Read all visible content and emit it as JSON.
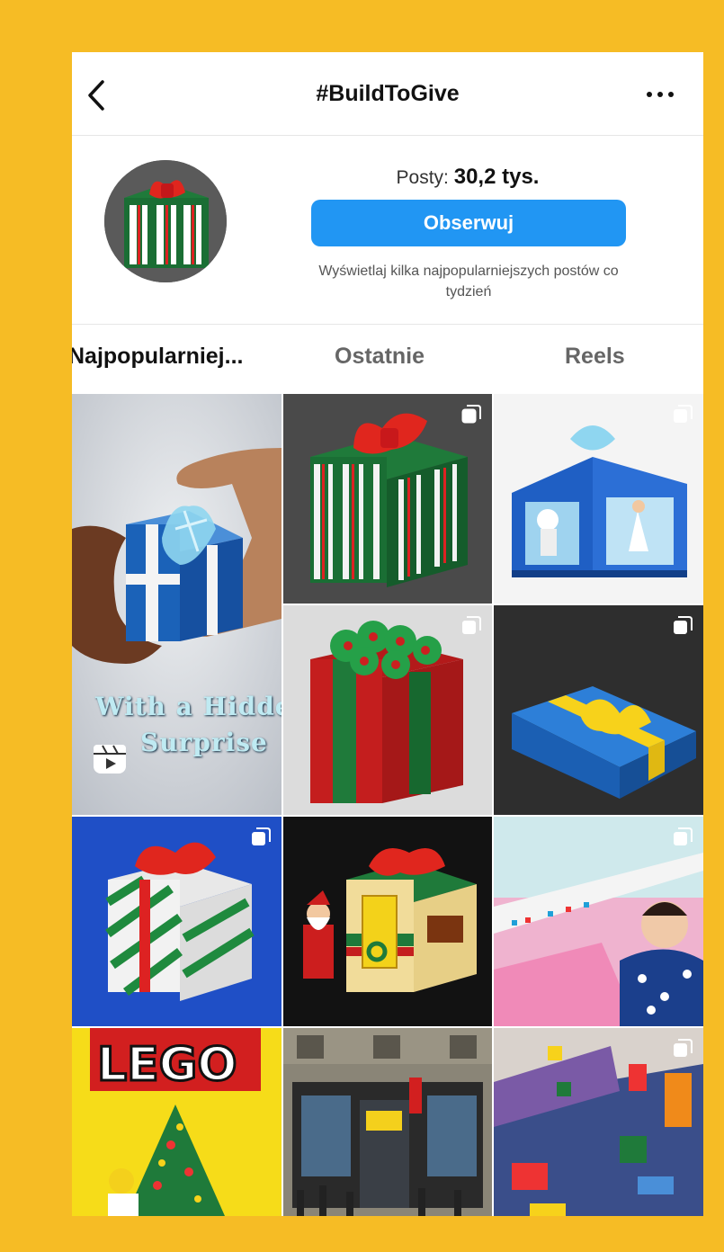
{
  "header": {
    "title": "#BuildToGive",
    "back_icon": "chevron-left-icon",
    "more_icon": "more-horizontal-icon"
  },
  "profile": {
    "posts_label": "Posty:",
    "posts_count": "30,2 tys.",
    "follow_label": "Obserwuj",
    "follow_hint": "Wyświetlaj kilka najpopularniejszych postów co tydzień"
  },
  "tabs": [
    {
      "label": "Najpopularniej...",
      "active": true
    },
    {
      "label": "Ostatnie",
      "active": false
    },
    {
      "label": "Reels",
      "active": false
    }
  ],
  "grid": {
    "featured_caption": [
      "With a Hidden",
      "Surprise"
    ],
    "tiles": [
      {
        "name": "reel-hidden-surprise-gift",
        "type": "reel"
      },
      {
        "name": "striped-gift-box",
        "type": "multi"
      },
      {
        "name": "blue-diorama-gift",
        "type": "multi"
      },
      {
        "name": "rose-gift-box",
        "type": "multi"
      },
      {
        "name": "blue-yellow-gift",
        "type": "multi"
      },
      {
        "name": "swirl-gift-box",
        "type": "multi"
      },
      {
        "name": "santa-gift-house",
        "type": "single"
      },
      {
        "name": "child-building-photo",
        "type": "multi"
      },
      {
        "name": "lego-tree-photo",
        "type": "single"
      },
      {
        "name": "lego-store-photo",
        "type": "single"
      },
      {
        "name": "lego-baseplate-photo",
        "type": "multi"
      }
    ]
  },
  "colors": {
    "background": "#F6BC25",
    "button": "#2196F3"
  }
}
